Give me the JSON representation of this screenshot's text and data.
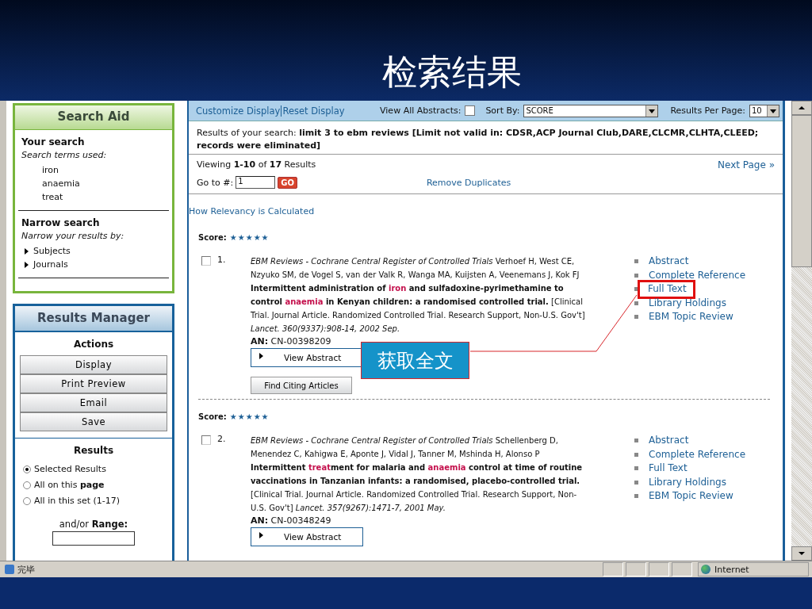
{
  "slide": {
    "title": "检索结果"
  },
  "search_aid": {
    "title": "Search Aid",
    "your_search": {
      "heading": "Your search",
      "subheading": "Search terms used:",
      "terms": [
        "iron",
        "anaemia",
        "treat"
      ]
    },
    "narrow": {
      "heading": "Narrow search",
      "subheading": "Narrow your results by:",
      "items": [
        {
          "label": "Subjects",
          "expanded": false
        },
        {
          "label": "Journals",
          "expanded": false
        }
      ]
    }
  },
  "results_manager": {
    "title": "Results Manager",
    "actions_heading": "Actions",
    "actions": [
      "Display",
      "Print Preview",
      "Email",
      "Save"
    ],
    "results_heading": "Results",
    "options": [
      {
        "label": "Selected Results",
        "selected": true
      },
      {
        "label": "All on this **page**",
        "selected": false
      },
      {
        "label": "All in this set (1-17)",
        "selected": false
      }
    ],
    "range_label": "and/or **Range:**"
  },
  "toolbar": {
    "links": [
      "Customize Display",
      "Reset Display"
    ],
    "view_all_abstracts": {
      "label": "View All Abstracts:",
      "checked": false
    },
    "sort": {
      "label": "Sort By:",
      "value": "SCORE"
    },
    "per_page": {
      "label": "Results Per Page:",
      "value": "10"
    }
  },
  "search_summary": "Results of your search: **limit 3 to ebm reviews [Limit not valid in: CDSR,ACP Journal Club,DARE,CLCMR,CLHTA,CLEED; records were eliminated]**",
  "paging": {
    "viewing": "Viewing **1-10** of **17** Results",
    "next": "Next Page »",
    "goto_label": "Go to #:",
    "goto_value": "1",
    "go_button": "GO",
    "remove_duplicates": "Remove Duplicates"
  },
  "relevancy_link": "How Relevancy is Calculated",
  "results": [
    {
      "score_label": "Score:",
      "stars": 5,
      "number": "1.",
      "checked": false,
      "citation": [
        {
          "kind": "source",
          "text": "EBM Reviews - Cochrane Central Register of Controlled Trials"
        },
        {
          "kind": "plain",
          "text": " Verhoef H, West CE, Nzyuko SM, de Vogel S, van der Valk R, Wanga MA, Kuijsten A, Veenemans J, Kok FJ "
        },
        {
          "kind": "title",
          "text": "Intermittent administration of "
        },
        {
          "kind": "hit",
          "text": "iron"
        },
        {
          "kind": "title",
          "text": " and sulfadoxine-pyrimethamine to control "
        },
        {
          "kind": "hit",
          "text": "anaemia"
        },
        {
          "kind": "title",
          "text": " in Kenyan children: a randomised controlled trial."
        },
        {
          "kind": "plain",
          "text": " [Clinical Trial. Journal Article. Randomized Controlled Trial. Research Support, Non-U.S. Gov't] "
        },
        {
          "kind": "source",
          "text": "Lancet. 360(9337):908-14, 2002 Sep."
        }
      ],
      "an_label": "AN:",
      "an_value": "CN-00398209",
      "view_abstract": "View Abstract",
      "find_citing": "Find Citing Articles",
      "links": [
        {
          "label": "Abstract",
          "highlighted": false
        },
        {
          "label": "Complete Reference",
          "highlighted": false
        },
        {
          "label": "Full Text",
          "highlighted": true
        },
        {
          "label": "Library Holdings",
          "highlighted": false
        },
        {
          "label": "EBM Topic Review",
          "highlighted": false
        }
      ]
    },
    {
      "score_label": "Score:",
      "stars": 5,
      "number": "2.",
      "checked": false,
      "citation": [
        {
          "kind": "source",
          "text": "EBM Reviews - Cochrane Central Register of Controlled Trials"
        },
        {
          "kind": "plain",
          "text": " Schellenberg D, Menendez C, Kahigwa E, Aponte J, Vidal J, Tanner M, Mshinda H, Alonso P "
        },
        {
          "kind": "title",
          "text": "Intermittent "
        },
        {
          "kind": "hit",
          "text": "treat"
        },
        {
          "kind": "title",
          "text": "ment for malaria and "
        },
        {
          "kind": "hit",
          "text": "anaemia"
        },
        {
          "kind": "title",
          "text": " control at time of routine vaccinations in Tanzanian infants: a randomised, placebo-controlled trial."
        },
        {
          "kind": "plain",
          "text": " [Clinical Trial. Journal Article. Randomized Controlled Trial. Research Support, Non-U.S. Gov't] "
        },
        {
          "kind": "source",
          "text": "Lancet. 357(9267):1471-7, 2001 May."
        }
      ],
      "an_label": "AN:",
      "an_value": "CN-00348249",
      "view_abstract": "View Abstract",
      "links": [
        {
          "label": "Abstract",
          "highlighted": false
        },
        {
          "label": "Complete Reference",
          "highlighted": false
        },
        {
          "label": "Full Text",
          "highlighted": false
        },
        {
          "label": "Library Holdings",
          "highlighted": false
        },
        {
          "label": "EBM Topic Review",
          "highlighted": false
        }
      ]
    }
  ],
  "callout": {
    "text": "获取全文"
  },
  "status_bar": {
    "text": "完毕",
    "zone": "Internet"
  }
}
